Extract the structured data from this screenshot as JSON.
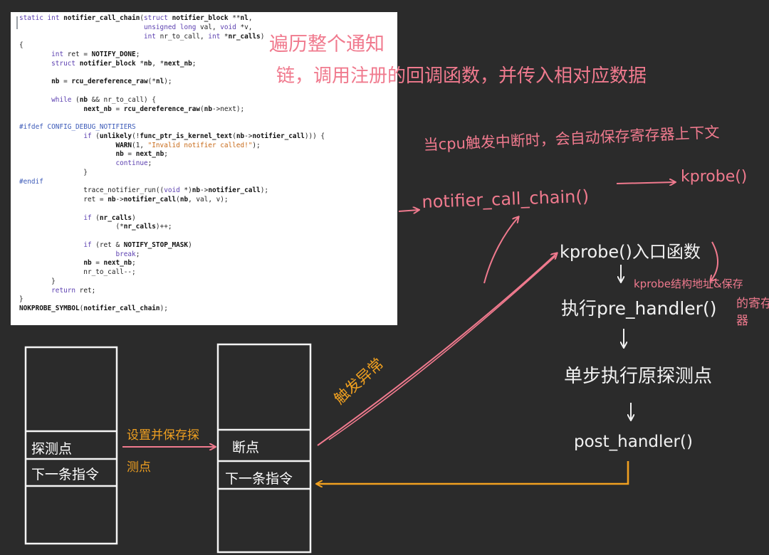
{
  "code": {
    "lines": [
      "static int notifier_call_chain(struct notifier_block **nl,",
      "                               unsigned long val, void *v,",
      "                               int nr_to_call, int *nr_calls)",
      "{",
      "        int ret = NOTIFY_DONE;",
      "        struct notifier_block *nb, *next_nb;",
      "",
      "        nb = rcu_dereference_raw(*nl);",
      "",
      "        while (nb && nr_to_call) {",
      "                next_nb = rcu_dereference_raw(nb->next);",
      "",
      "#ifdef CONFIG_DEBUG_NOTIFIERS",
      "                if (unlikely(!func_ptr_is_kernel_text(nb->notifier_call))) {",
      "                        WARN(1, \"Invalid notifier called!\");",
      "                        nb = next_nb;",
      "                        continue;",
      "                }",
      "#endif",
      "                trace_notifier_run((void *)nb->notifier_call);",
      "                ret = nb->notifier_call(nb, val, v);",
      "",
      "                if (nr_calls)",
      "                        (*nr_calls)++;",
      "",
      "                if (ret & NOTIFY_STOP_MASK)",
      "                        break;",
      "                nb = next_nb;",
      "                nr_to_call--;",
      "        }",
      "        return ret;",
      "}",
      "NOKPROBE_SYMBOL(notifier_call_chain);"
    ]
  },
  "annotations": {
    "traverse_line1": "遍历整个通知",
    "traverse_line2": "链，调用注册的回调函数，并传入相对应数据",
    "cpu_note": "当cpu触发中断时，会自动保存寄存器上下文",
    "chain_call": "notifier_call_chain()",
    "kprobe_fn": "kprobe()",
    "kprobe_entry": "kprobe()入口函数",
    "kprobe_struct_line1": "kprobe结构地址&保存",
    "kprobe_struct_line2": "的寄存",
    "kprobe_struct_line3": "器",
    "exec_pre": "执行pre_handler()",
    "single_step": "单步执行原探测点",
    "post": "post_handler()",
    "trigger": "触发异常",
    "set_save_line1": "设置并保存探",
    "set_save_line2": "测点"
  },
  "left_block": {
    "probe_point": "探测点",
    "next_instruction": "下一条指令"
  },
  "right_block": {
    "breakpoint": "断点",
    "next_instruction": "下一条指令"
  },
  "colors": {
    "background": "#2b2b2b",
    "pink_ink": "#f07a8e",
    "orange_ink": "#f0a020",
    "white_ink": "#f2f2f2"
  }
}
